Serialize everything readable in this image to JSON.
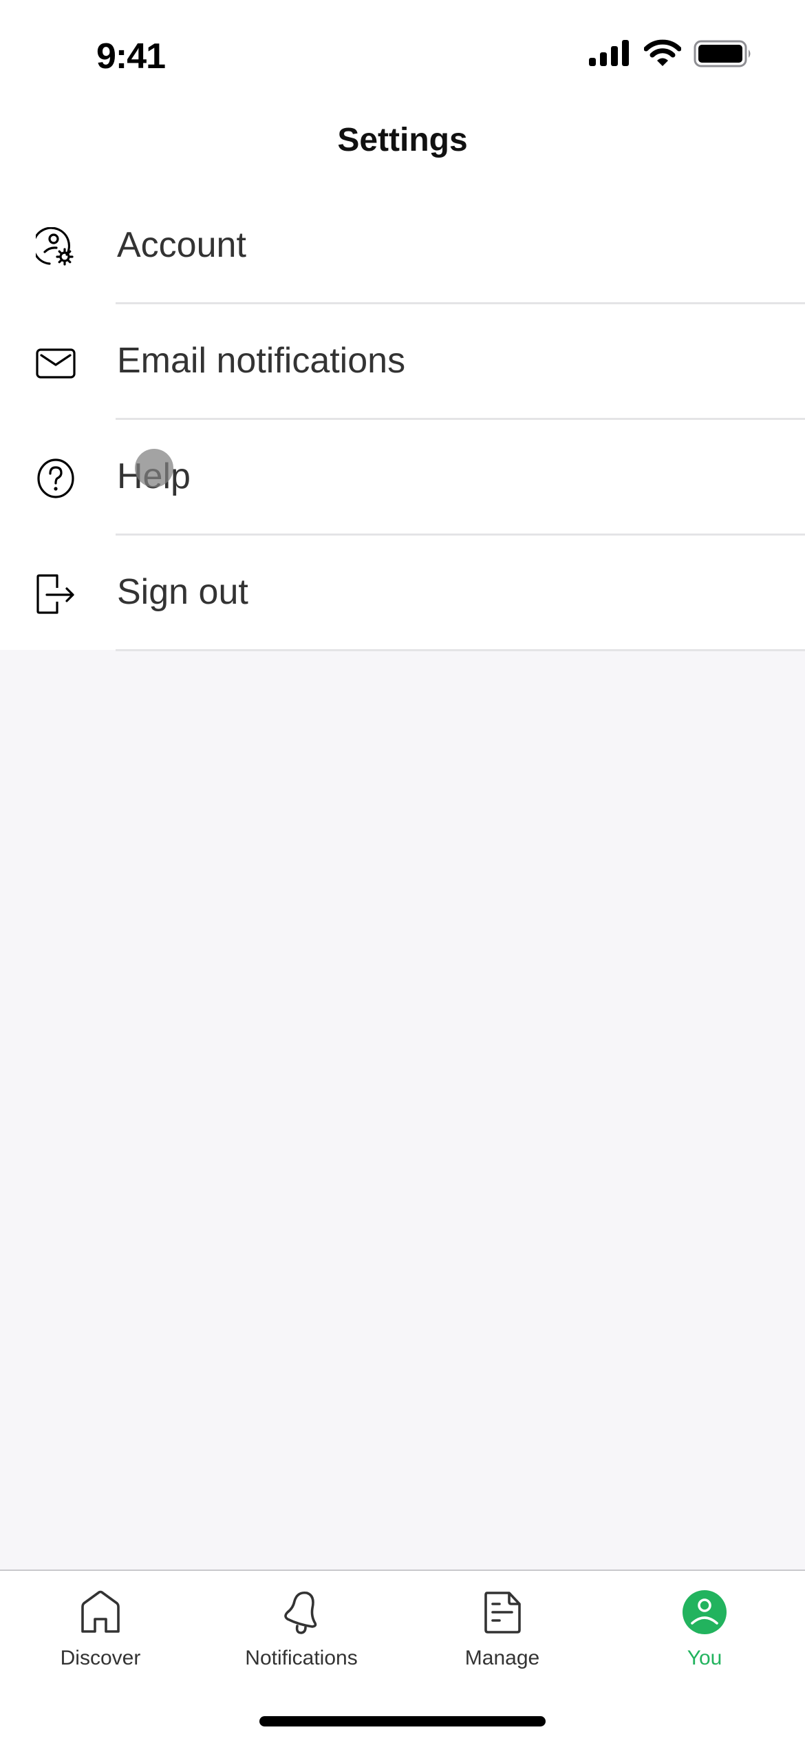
{
  "status_bar": {
    "time": "9:41",
    "icons": [
      "cellular-signal-icon",
      "wifi-icon",
      "battery-icon"
    ]
  },
  "header": {
    "title": "Settings"
  },
  "settings": {
    "items": [
      {
        "label": "Account",
        "icon": "account-settings-icon"
      },
      {
        "label": "Email notifications",
        "icon": "envelope-icon"
      },
      {
        "label": "Help",
        "icon": "question-circle-icon"
      },
      {
        "label": "Sign out",
        "icon": "sign-out-icon"
      }
    ]
  },
  "tab_bar": {
    "active_color": "#22B35E",
    "tabs": [
      {
        "label": "Discover",
        "icon": "home-icon",
        "active": false
      },
      {
        "label": "Notifications",
        "icon": "bell-icon",
        "active": false
      },
      {
        "label": "Manage",
        "icon": "document-icon",
        "active": false
      },
      {
        "label": "You",
        "icon": "user-circle-icon",
        "active": true
      }
    ]
  }
}
